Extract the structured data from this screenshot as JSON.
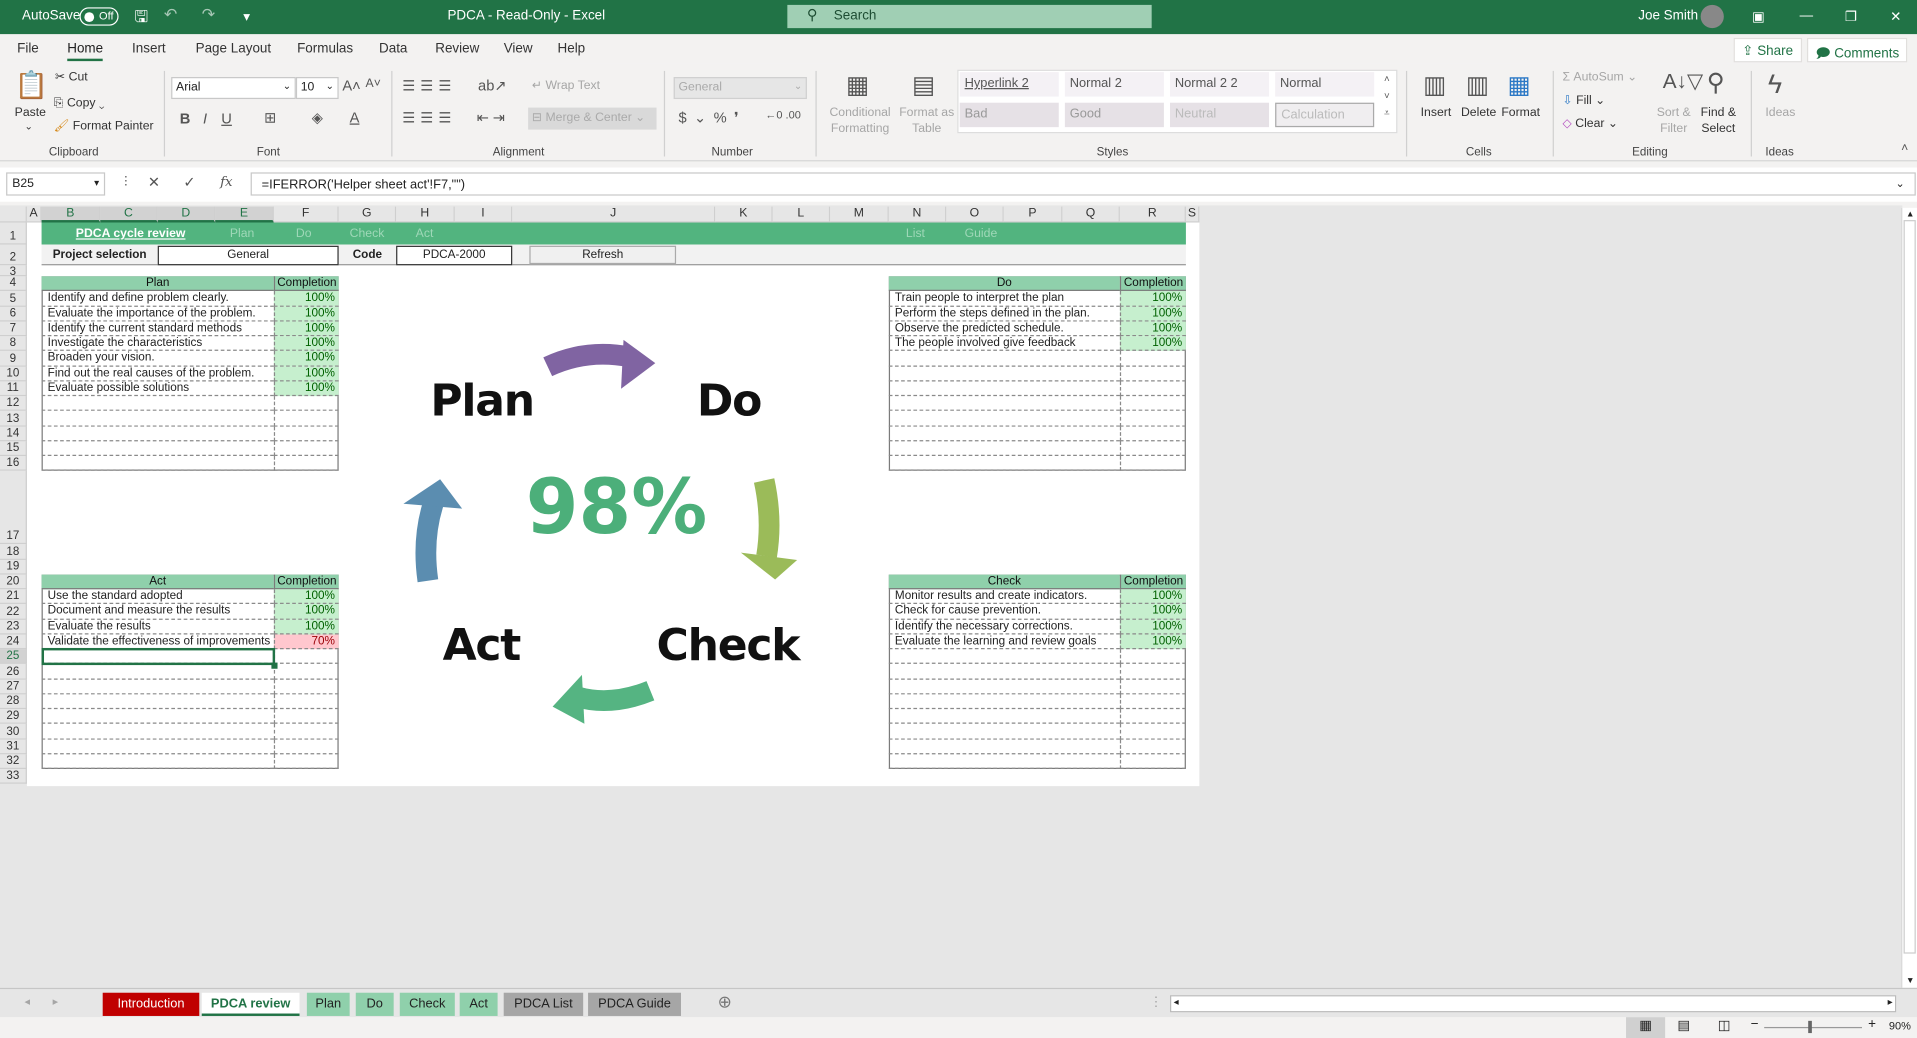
{
  "title_bar": {
    "autosave_label": "AutoSave",
    "autosave_state": "Off",
    "title": "PDCA  -  Read-Only  -  Excel",
    "search_placeholder": "Search",
    "user": "Joe Smith"
  },
  "menu": [
    "File",
    "Home",
    "Insert",
    "Page Layout",
    "Formulas",
    "Data",
    "Review",
    "View",
    "Help"
  ],
  "share_label": "Share",
  "comments_label": "Comments",
  "ribbon": {
    "clipboard": {
      "paste": "Paste",
      "cut": "Cut",
      "copy": "Copy",
      "format_painter": "Format Painter",
      "label": "Clipboard"
    },
    "font": {
      "name": "Arial",
      "size": "10",
      "label": "Font"
    },
    "alignment": {
      "wrap": "Wrap Text",
      "merge": "Merge & Center",
      "label": "Alignment"
    },
    "number": {
      "format": "General",
      "label": "Number"
    },
    "styles": {
      "conditional": "Conditional Formatting",
      "format_table": "Format as Table",
      "cells": [
        "Hyperlink 2",
        "Normal 2",
        "Normal 2 2",
        "Normal",
        "Bad",
        "Good",
        "Neutral",
        "Calculation"
      ],
      "label": "Styles"
    },
    "cells": {
      "insert": "Insert",
      "delete": "Delete",
      "format": "Format",
      "label": "Cells"
    },
    "editing": {
      "autosum": "AutoSum",
      "fill": "Fill",
      "clear": "Clear",
      "sort": "Sort & Filter",
      "find": "Find & Select",
      "label": "Editing"
    },
    "ideas": {
      "button": "Ideas",
      "label": "Ideas"
    }
  },
  "formula_bar": {
    "name_box": "B25",
    "formula": "=IFERROR('Helper sheet act'!F7,\"\")"
  },
  "columns": [
    "A",
    "B",
    "C",
    "D",
    "E",
    "F",
    "G",
    "H",
    "I",
    "J",
    "K",
    "L",
    "M",
    "N",
    "O",
    "P",
    "Q",
    "R",
    "S"
  ],
  "sheet": {
    "nav": {
      "home": "PDCA cycle review",
      "links": [
        "Plan",
        "Do",
        "Check",
        "Act",
        "List",
        "Guide"
      ]
    },
    "project_label": "Project selection",
    "project_value": "General",
    "code_label": "Code",
    "code_value": "PDCA-2000",
    "refresh": "Refresh",
    "completion_header": "Completion",
    "plan": {
      "title": "Plan",
      "items": [
        [
          "Identify and define problem clearly.",
          "100%"
        ],
        [
          "Evaluate the importance of the problem.",
          "100%"
        ],
        [
          "Identify the current standard methods",
          "100%"
        ],
        [
          "Investigate the characteristics",
          "100%"
        ],
        [
          "Broaden your vision.",
          "100%"
        ],
        [
          "Find out the real causes of the problem.",
          "100%"
        ],
        [
          "Evaluate possible solutions",
          "100%"
        ]
      ]
    },
    "do": {
      "title": "Do",
      "items": [
        [
          "Train people to interpret the plan",
          "100%"
        ],
        [
          "Perform the steps defined in the plan.",
          "100%"
        ],
        [
          "Observe the predicted schedule.",
          "100%"
        ],
        [
          "The people involved give feedback",
          "100%"
        ]
      ]
    },
    "act": {
      "title": "Act",
      "items": [
        [
          "Use the standard adopted",
          "100%"
        ],
        [
          "Document and measure the results",
          "100%"
        ],
        [
          "Evaluate the results",
          "100%"
        ],
        [
          "Validate the effectiveness of improvements",
          "70%"
        ]
      ]
    },
    "check": {
      "title": "Check",
      "items": [
        [
          "Monitor results and create indicators.",
          "100%"
        ],
        [
          "Check for cause prevention.",
          "100%"
        ],
        [
          "Identify the necessary corrections.",
          "100%"
        ],
        [
          "Evaluate the learning and review goals",
          "100%"
        ]
      ]
    },
    "cycle": {
      "plan": "Plan",
      "do": "Do",
      "check": "Check",
      "act": "Act",
      "overall": "98%"
    }
  },
  "sheet_tabs": [
    {
      "label": "Introduction",
      "color": "#c00000",
      "text": "#ffffff"
    },
    {
      "label": "PDCA review",
      "color": "#ffffff",
      "text": "#217346",
      "active": true
    },
    {
      "label": "Plan",
      "color": "#8fd0ab",
      "text": "#222"
    },
    {
      "label": "Do",
      "color": "#8fd0ab",
      "text": "#222"
    },
    {
      "label": "Check",
      "color": "#8fd0ab",
      "text": "#222"
    },
    {
      "label": "Act",
      "color": "#8fd0ab",
      "text": "#222"
    },
    {
      "label": "PDCA List",
      "color": "#a6a6a6",
      "text": "#222"
    },
    {
      "label": "PDCA Guide",
      "color": "#a6a6a6",
      "text": "#222"
    }
  ],
  "status": {
    "zoom": "90%"
  },
  "colors": {
    "excel_green": "#217346",
    "band": "#52b47f",
    "header": "#8fd0ab",
    "good": "#c6efce",
    "bad": "#ffc7ce",
    "plan_arrow": "#8064a2",
    "do_arrow": "#9bbb59",
    "check_arrow": "#55b482",
    "act_arrow": "#5b8db0",
    "percent": "#4caf7a"
  }
}
